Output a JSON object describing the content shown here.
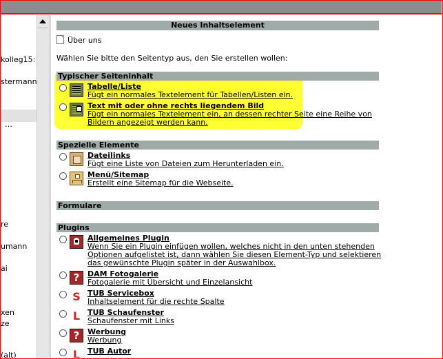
{
  "left_panel": {
    "lines": [
      "kolleg15:",
      "stermann",
      "…",
      "re",
      "umann",
      "ai",
      "xen",
      "ze",
      "(alt)"
    ]
  },
  "main": {
    "title": "Neues Inhaltselement",
    "breadcrumb": "Über uns",
    "intro": "Wählen Sie bitte den Seitentyp aus, den Sie erstellen wollen:",
    "sections": {
      "typical": "Typischer Seiteninhalt",
      "special": "Spezielle Elemente",
      "forms": "Formulare",
      "plugins": "Plugins"
    },
    "items": {
      "table": {
        "label": "Tabelle/Liste",
        "desc": "Fügt ein normales Textelement für Tabellen/Listen ein."
      },
      "textimage": {
        "label": "Text mit oder ohne rechts liegendem Bild",
        "desc": "Fügt ein normales Textelement ein, an dessen rechter Seite eine Reihe von Bildern angezeigt werden kann."
      },
      "filelinks": {
        "label": "Dateilinks",
        "desc": "Fügt eine Liste von Dateien zum Herunterladen ein."
      },
      "sitemap": {
        "label": "Menü/Sitemap",
        "desc": "Erstellt eine Sitemap für die Webseite."
      },
      "general_plugin": {
        "label": "Allgemeines Plugin",
        "desc": "Wenn Sie ein Plugin einfügen wollen, welches nicht in den unten stehenden Optionen aufgelistet ist, dann wählen Sie diesen Element-Typ und selektieren das gewünschte Plugin später in der Auswahlbox."
      },
      "dam_gallery": {
        "label": "DAM Fotogalerie",
        "desc": "Fotogalerie mit Übersicht und Einzelansicht"
      },
      "servicebox": {
        "label": "TUB Servicebox",
        "desc": "Inhaltselement für die rechte Spalte",
        "icon_letter": "S"
      },
      "schaufenster": {
        "label": "TUB Schaufenster",
        "desc": "Schaufenster mit Links",
        "icon_letter": "L"
      },
      "werbung": {
        "label": "Werbung",
        "desc": "Werbung"
      },
      "autor": {
        "label": "TUB Autor",
        "desc": "",
        "icon_letter": "L"
      }
    },
    "icons": {
      "table": "table-icon",
      "textimage": "text-image-icon",
      "filelinks": "file-links-icon",
      "sitemap": "sitemap-icon",
      "general_plugin": "plugin-icon",
      "question": "question-mark-icon"
    }
  },
  "colors": {
    "section_bar": "#a0aaa8",
    "highlight": "#ffff33",
    "frame_border": "#ff0000"
  }
}
